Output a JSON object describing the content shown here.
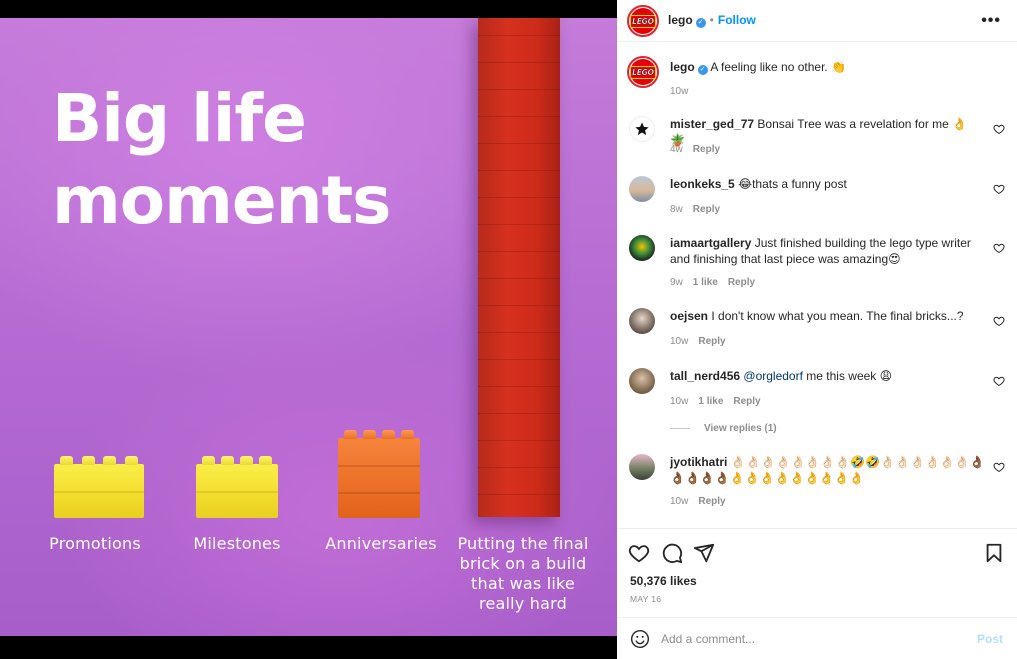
{
  "image": {
    "headline_line1": "Big life",
    "headline_line2": "moments",
    "captions": {
      "promotions": "Promotions",
      "milestones": "Milestones",
      "anniversaries": "Anniversaries",
      "final_brick_1": "Putting the final",
      "final_brick_2": "brick on a build",
      "final_brick_3": "that was like",
      "final_brick_4": "really hard"
    },
    "colors": {
      "background": "#b66cd3",
      "yellow": "#f2dc2c",
      "orange": "#ec6f27",
      "red": "#d6301f"
    }
  },
  "header": {
    "username": "lego",
    "follow_label": "Follow",
    "separator": "•",
    "more_label": "•••",
    "avatar_text": "LEGO"
  },
  "caption": {
    "username": "lego",
    "text": "A feeling like no other. 👏",
    "time": "10w"
  },
  "comments": [
    {
      "username": "mister_ged_77",
      "text": "Bonsai Tree was a revelation for me 👌🪴",
      "time": "4w",
      "likes": "",
      "reply": "Reply"
    },
    {
      "username": "leonkeks_5",
      "text": "😂thats a funny post",
      "time": "8w",
      "likes": "",
      "reply": "Reply"
    },
    {
      "username": "iamaartgallery",
      "text": "Just finished building the lego type writer and finishing that last piece was amazing😍",
      "time": "9w",
      "likes": "1 like",
      "reply": "Reply"
    },
    {
      "username": "oejsen",
      "text": "I don't know what you mean. The final bricks...?",
      "time": "10w",
      "likes": "",
      "reply": "Reply"
    },
    {
      "username": "tall_nerd456",
      "mention": "@orgledorf",
      "text": "me this week 😩",
      "time": "10w",
      "likes": "1 like",
      "reply": "Reply"
    },
    {
      "username": "jyotikhatri",
      "text": "👌🏻👌🏻👌🏻👌🏻👌🏻👌🏻👌🏻👌🏻🤣🤣👌🏻👌🏻👌🏻👌🏻👌🏻👌🏻👌🏾👌🏾👌🏾👌🏾👌🏾👌👌👌👌👌👌👌👌👌",
      "time": "10w",
      "likes": "",
      "reply": "Reply"
    }
  ],
  "view_replies": "View replies (1)",
  "stats": {
    "likes": "50,376 likes",
    "date": "MAY 16"
  },
  "add_comment": {
    "placeholder": "Add a comment...",
    "post_label": "Post"
  },
  "accent_color": "#0095f6"
}
